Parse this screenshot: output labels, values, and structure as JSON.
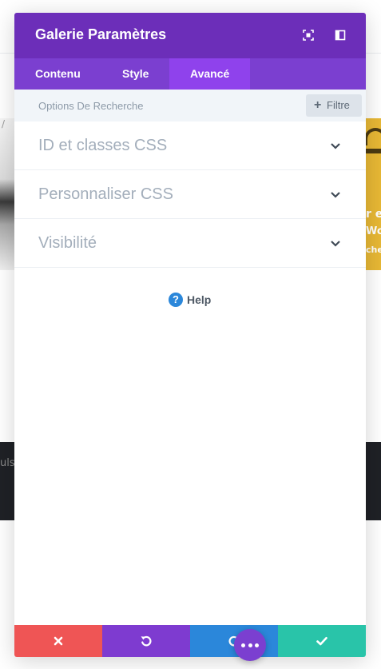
{
  "modal": {
    "title": "Galerie Paramètres",
    "header_icons": [
      "fullscreen-icon",
      "sidebar-toggle-icon"
    ],
    "tabs": [
      {
        "label": "Contenu",
        "active": false
      },
      {
        "label": "Style",
        "active": false
      },
      {
        "label": "Avancé",
        "active": true
      }
    ],
    "search": {
      "label": "Options De Recherche",
      "filter_label": "Filtre",
      "filter_icon": "plus-icon"
    },
    "sections": [
      {
        "label": "ID et classes CSS",
        "icon": "chevron-down-icon"
      },
      {
        "label": "Personnaliser CSS",
        "icon": "chevron-down-icon"
      },
      {
        "label": "Visibilité",
        "icon": "chevron-down-icon"
      }
    ],
    "help": {
      "icon_glyph": "?",
      "label": "Help"
    },
    "footer": [
      {
        "action": "cancel",
        "icon": "close-icon",
        "color": "#ef5555"
      },
      {
        "action": "undo",
        "icon": "undo-icon",
        "color": "#7e3bd0"
      },
      {
        "action": "redo",
        "icon": "redo-icon",
        "color": "#2b87da"
      },
      {
        "action": "save",
        "icon": "check-icon",
        "color": "#29c4a9"
      }
    ],
    "more_button": {
      "icon": "more-dots-icon",
      "color": "#7b3fd0"
    }
  },
  "colors": {
    "header": "#6c2eb9",
    "tabs": "#7b3fd0",
    "active_tab": "#8f42ec",
    "help_icon": "#2b87da"
  },
  "background": {
    "right_card_lines": [
      "r e",
      "Woc",
      "che"
    ],
    "dark_band_text": "ulse"
  }
}
